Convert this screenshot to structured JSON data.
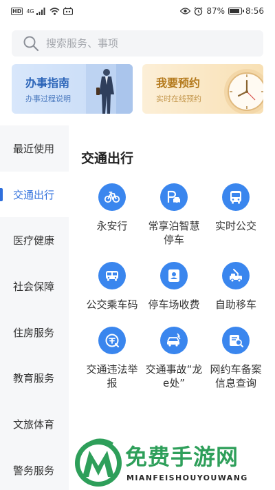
{
  "status_bar": {
    "left_badge": "HD",
    "signal_label": "4G",
    "battery_percent": 87,
    "battery_text": "87%",
    "time": "8:56",
    "icons": [
      "hd-icon",
      "signal-icon",
      "wifi-icon",
      "notification-app-icon",
      "eye-icon",
      "alarm-icon",
      "battery-icon"
    ]
  },
  "search": {
    "placeholder": "搜索服务、事项"
  },
  "banners": {
    "guide": {
      "title": "办事指南",
      "subtitle": "办事过程说明"
    },
    "appointment": {
      "title": "我要预约",
      "subtitle": "实时在线预约"
    }
  },
  "sidebar": {
    "items": [
      {
        "label": "最近使用",
        "active": false
      },
      {
        "label": "交通出行",
        "active": true
      },
      {
        "label": "医疗健康",
        "active": false
      },
      {
        "label": "社会保障",
        "active": false
      },
      {
        "label": "住房服务",
        "active": false
      },
      {
        "label": "教育服务",
        "active": false
      },
      {
        "label": "文旅体育",
        "active": false
      },
      {
        "label": "警务服务",
        "active": false
      }
    ]
  },
  "main": {
    "section_title": "交通出行",
    "services": [
      {
        "label": "永安行",
        "icon": "bicycle-icon"
      },
      {
        "label": "常享泊智慧停车",
        "icon": "parking-icon"
      },
      {
        "label": "实时公交",
        "icon": "bus-icon"
      },
      {
        "label": "公交乘车码",
        "icon": "bus-code-icon"
      },
      {
        "label": "停车场收费",
        "icon": "parking-fee-icon"
      },
      {
        "label": "自助移车",
        "icon": "tow-truck-icon"
      },
      {
        "label": "交通违法举报",
        "icon": "violation-report-icon"
      },
      {
        "label": "交通事故“龙e处”",
        "icon": "car-accident-icon"
      },
      {
        "label": "网约车备案信息查询",
        "icon": "ride-hailing-query-icon"
      }
    ]
  },
  "watermark": {
    "title": "免费手游网",
    "subtitle": "MIANFEISHOUYOUWANG"
  },
  "colors": {
    "accent": "#2f6fdc",
    "icon_bg": "#3a86ee",
    "watermark_green": "#2e9f5a"
  }
}
